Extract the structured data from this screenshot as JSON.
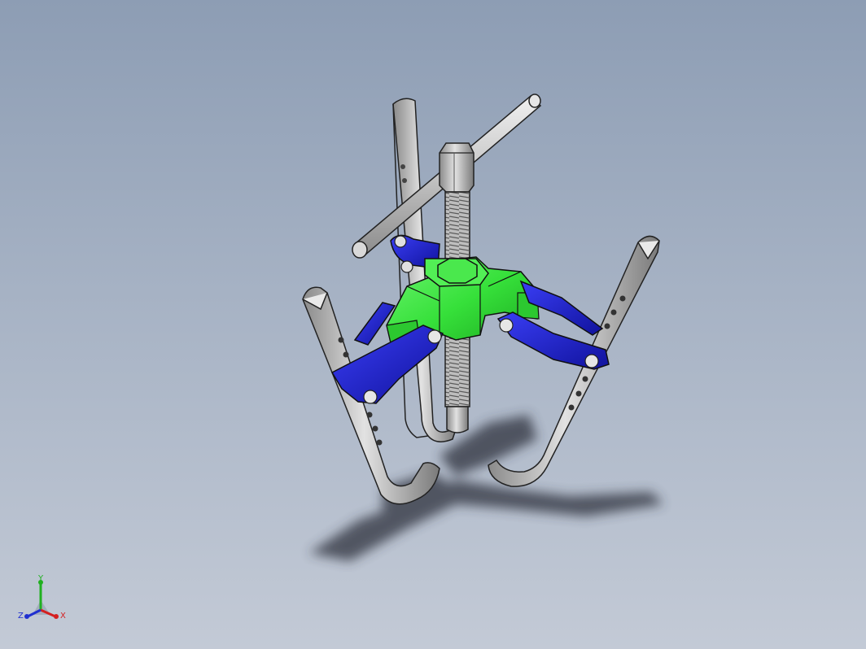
{
  "viewport": {
    "background_top": "#8d9db4",
    "background_bottom": "#c3cad6"
  },
  "model": {
    "parts": [
      "three-jaw-gear-puller",
      "handle-bar",
      "hex-head-screw",
      "threaded-spindle",
      "yoke-body",
      "link-arms",
      "jaw-legs",
      "pivot-bolts"
    ],
    "colors": {
      "yoke": "#36e03a",
      "links": "#1a1ee0",
      "steel": "#c8c8c8",
      "shadow": "#3a3f4a"
    }
  },
  "triad": {
    "x_label": "X",
    "y_label": "Y",
    "z_label": "Z",
    "x_color": "#d42020",
    "y_color": "#20b020",
    "z_color": "#2030d0"
  }
}
